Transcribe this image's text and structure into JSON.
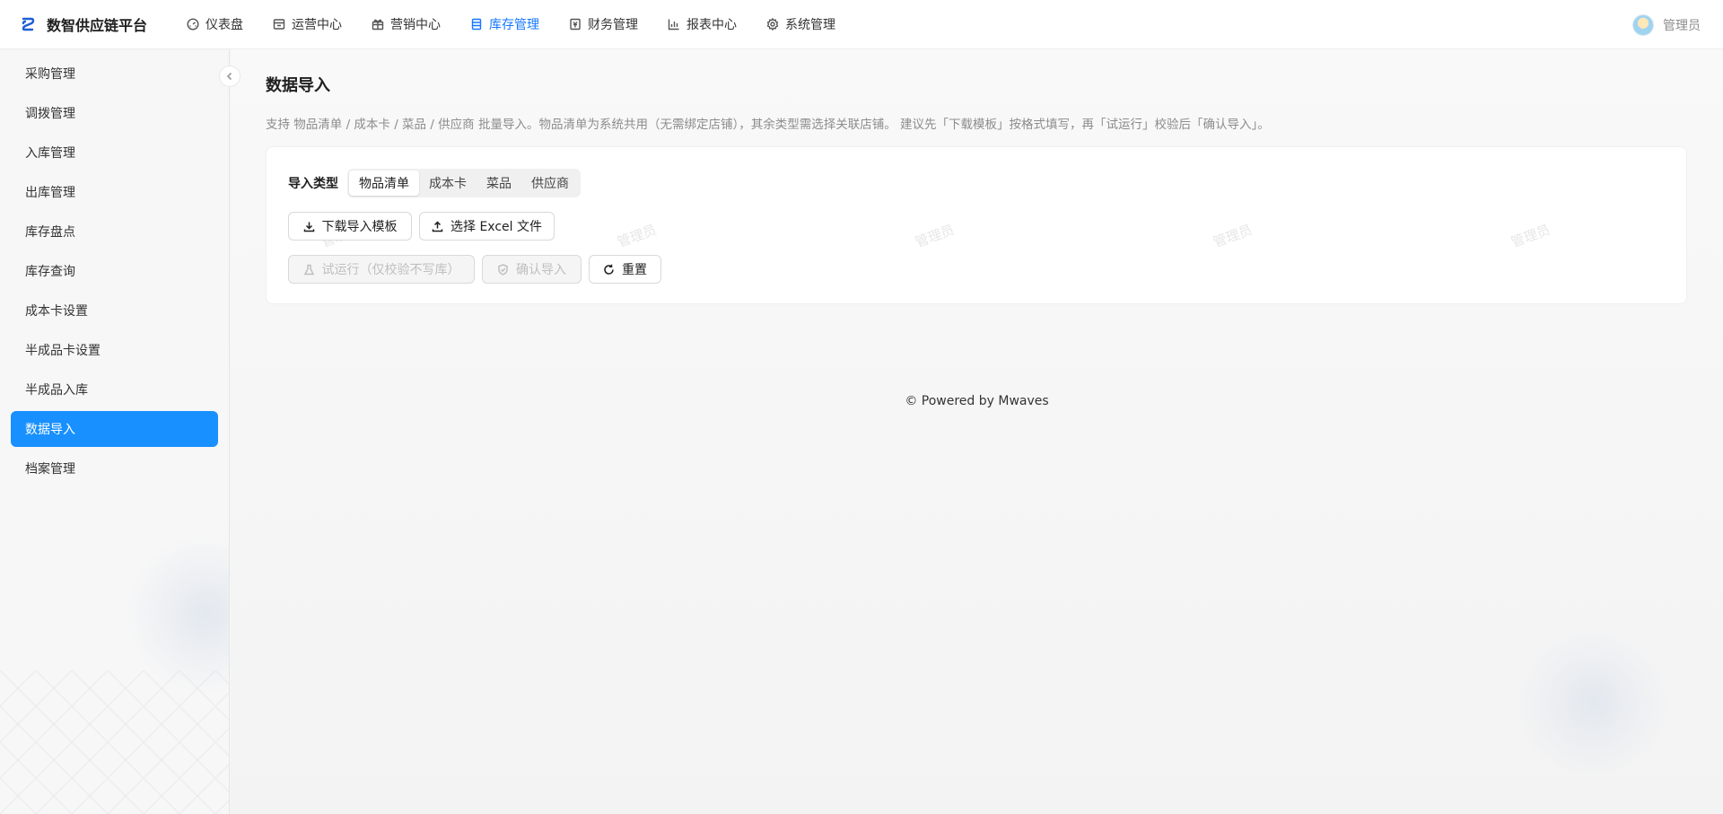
{
  "header": {
    "brand_title": "数智供应链平台",
    "nav": [
      {
        "label": "仪表盘",
        "icon": "dashboard-icon"
      },
      {
        "label": "运营中心",
        "icon": "store-icon"
      },
      {
        "label": "营销中心",
        "icon": "gift-icon"
      },
      {
        "label": "库存管理",
        "icon": "inventory-icon",
        "active": true
      },
      {
        "label": "财务管理",
        "icon": "finance-icon"
      },
      {
        "label": "报表中心",
        "icon": "bar-chart-icon"
      },
      {
        "label": "系统管理",
        "icon": "gear-icon"
      }
    ],
    "user_name": "管理员"
  },
  "sidebar": {
    "items": [
      {
        "label": "采购管理"
      },
      {
        "label": "调拨管理"
      },
      {
        "label": "入库管理"
      },
      {
        "label": "出库管理"
      },
      {
        "label": "库存盘点"
      },
      {
        "label": "库存查询"
      },
      {
        "label": "成本卡设置"
      },
      {
        "label": "半成品卡设置"
      },
      {
        "label": "半成品入库"
      },
      {
        "label": "数据导入",
        "active": true
      },
      {
        "label": "档案管理"
      }
    ]
  },
  "main": {
    "title": "数据导入",
    "description": "支持 物品清单 / 成本卡 / 菜品 / 供应商 批量导入。物品清单为系统共用（无需绑定店铺），其余类型需选择关联店铺。 建议先「下载模板」按格式填写，再「试运行」校验后「确认导入」。",
    "import_type_label": "导入类型",
    "import_types": [
      "物品清单",
      "成本卡",
      "菜品",
      "供应商"
    ],
    "selected_import_type": "物品清单",
    "buttons": {
      "download_template": "下载导入模板",
      "select_file": "选择 Excel 文件",
      "dry_run": "试运行（仅校验不写库）",
      "confirm_import": "确认导入",
      "reset": "重置"
    },
    "watermark_text": "管理员"
  },
  "footer": {
    "text": "Powered by Mwaves"
  },
  "colors": {
    "accent": "#1677ff",
    "sidebar_active": "#1890ff"
  }
}
